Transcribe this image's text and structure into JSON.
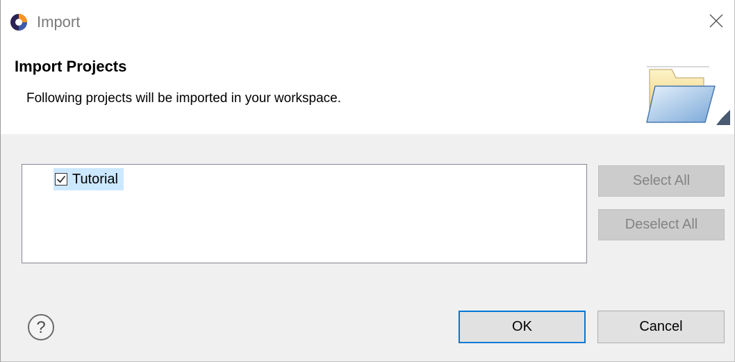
{
  "window": {
    "title": "Import"
  },
  "header": {
    "title": "Import Projects",
    "description": "Following projects will be imported in your workspace."
  },
  "projects": [
    {
      "label": "Tutorial",
      "checked": true
    }
  ],
  "buttons": {
    "select_all": "Select All",
    "deselect_all": "Deselect All",
    "ok": "OK",
    "cancel": "Cancel"
  },
  "icons": {
    "app": "eclipse-icon",
    "close": "close-icon",
    "banner": "open-folder-icon",
    "help": "help-icon",
    "checkbox": "checkbox-checked-icon"
  },
  "colors": {
    "selection": "#cce8ff",
    "default_button_border": "#0078d7",
    "disabled_text": "#838383"
  }
}
